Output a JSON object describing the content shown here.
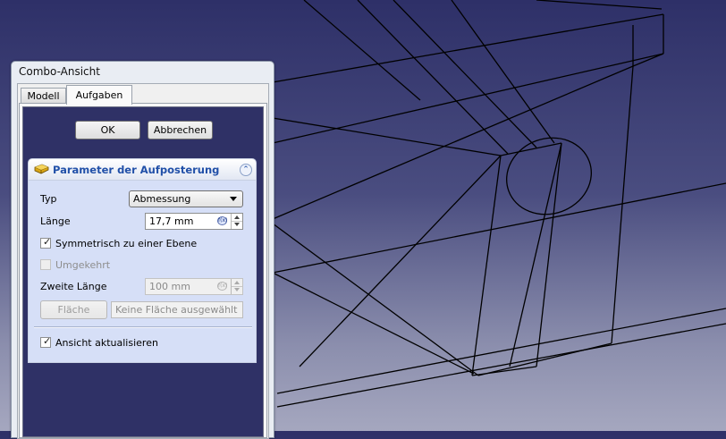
{
  "window": {
    "title": "Combo-Ansicht"
  },
  "tabs": [
    {
      "label": "Modell",
      "active": false
    },
    {
      "label": "Aufgaben",
      "active": true
    }
  ],
  "dialog_buttons": {
    "ok": "OK",
    "cancel": "Abbrechen"
  },
  "panel": {
    "title": "Parameter der Aufposterung",
    "type_label": "Typ",
    "type_value": "Abmessung",
    "length_label": "Länge",
    "length_value": "17,7 mm",
    "symmetric_label": "Symmetrisch zu einer Ebene",
    "symmetric_checked": true,
    "reversed_label": "Umgekehrt",
    "reversed_checked": false,
    "second_length_label": "Zweite Länge",
    "second_length_value": "100 mm",
    "face_button": "Fläche",
    "face_placeholder": "Keine Fläche ausgewählt",
    "update_view_label": "Ansicht aktualisieren",
    "update_view_checked": true
  },
  "icons": {
    "pad": "pad-icon",
    "collapse": "collapse-up-icon",
    "expression": "expression-icon",
    "dropdown": "chevron-down-icon"
  },
  "colors": {
    "viewport_top": "#2e3068",
    "viewport_bottom": "#a5a7bf",
    "panel_title": "#2150a8",
    "panel_bg": "#d6dff7",
    "wireframe": "#000000"
  }
}
